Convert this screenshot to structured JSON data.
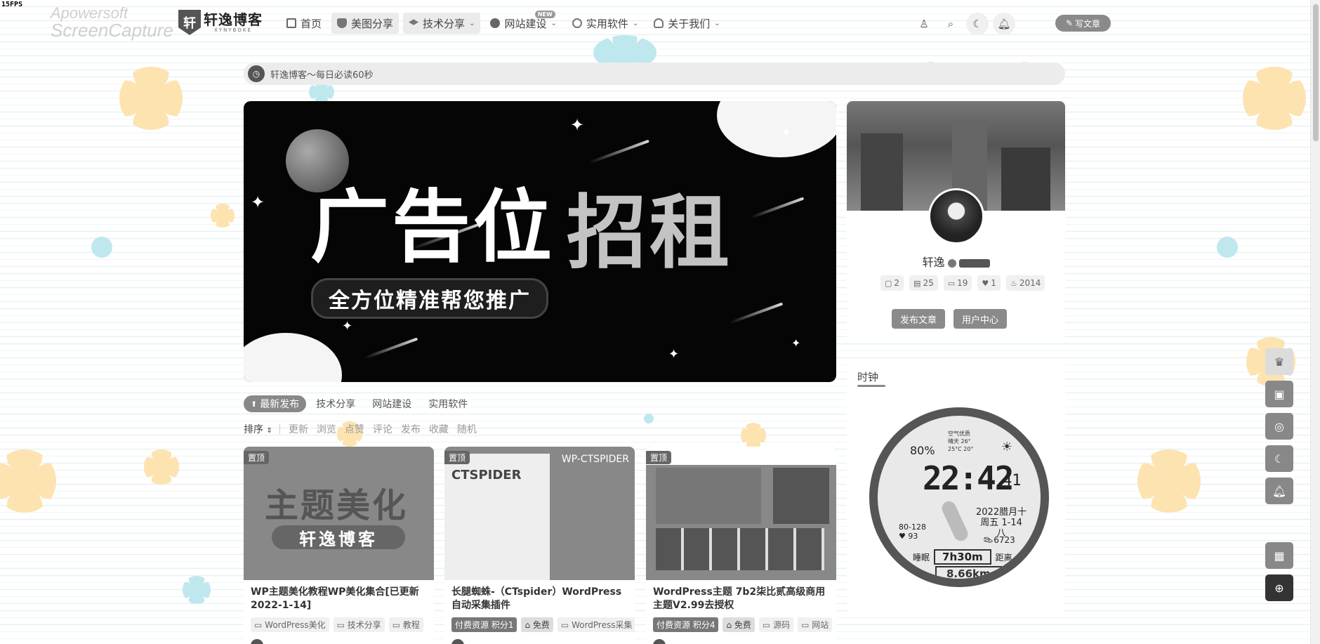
{
  "overlay": {
    "fps": "15FPS",
    "watermark_line1": "Apowersoft",
    "watermark_line2": "ScreenCapture"
  },
  "header": {
    "logo_name": "轩逸博客",
    "logo_sub": "XYNYBOKE",
    "nav": [
      {
        "label": "首页",
        "icon": "home-icon",
        "dropdown": false
      },
      {
        "label": "美图分享",
        "icon": "image-icon",
        "dropdown": false
      },
      {
        "label": "技术分享",
        "icon": "graduation-cap-icon",
        "dropdown": true
      },
      {
        "label": "网站建设",
        "icon": "globe-icon",
        "dropdown": true,
        "badge": "NEW"
      },
      {
        "label": "实用软件",
        "icon": "apps-icon",
        "dropdown": true
      },
      {
        "label": "关于我们",
        "icon": "users-icon",
        "dropdown": true
      }
    ],
    "write_button": "写文章"
  },
  "notice": {
    "text": "轩逸博客～每日必读60秒"
  },
  "banner": {
    "headline_a": "广告位",
    "headline_b": "招租",
    "slogan": "全方位精准帮您推广"
  },
  "tabs": {
    "items": [
      "最新发布",
      "技术分享",
      "网站建设",
      "实用软件"
    ],
    "active": 0
  },
  "sort": {
    "label": "排序",
    "options": [
      "更新",
      "浏览",
      "点赞",
      "评论",
      "发布",
      "收藏",
      "随机"
    ]
  },
  "cards": [
    {
      "pin": "置顶",
      "title": "WP主题美化教程WP美化集合[已更新2022-1-14]",
      "tags": [
        "WordPress美化",
        "技术分享",
        "教程"
      ],
      "thumb_big": "主题美化",
      "thumb_pill": "轩逸博客"
    },
    {
      "pin": "置顶",
      "title": "长腿蜘蛛-（CTspider）WordPress 自动采集插件",
      "tags": [
        "付费资源 积分1",
        "免费",
        "WordPress采集"
      ],
      "thumb_head": "WP-CTSPIDER",
      "thumb_box": "CTSPIDER"
    },
    {
      "pin": "置顶",
      "title": "WordPress主题 7b2柒比贰高级商用主题V2.99去授权",
      "tags": [
        "付费资源 积分4",
        "免费",
        "源码",
        "网站"
      ]
    }
  ],
  "profile": {
    "name": "轩逸",
    "stats": [
      {
        "icon": "comments-icon",
        "value": "2"
      },
      {
        "icon": "file-icon",
        "value": "25"
      },
      {
        "icon": "message-icon",
        "value": "19"
      },
      {
        "icon": "heart-icon",
        "value": "1"
      },
      {
        "icon": "fire-icon",
        "value": "2014"
      }
    ],
    "btn_publish": "发布文章",
    "btn_center": "用户中心"
  },
  "clock_widget": {
    "title": "时钟",
    "battery": "80%",
    "air_label": "空气优质",
    "weather": "晴天  26°",
    "temps": "25°C  20°",
    "time": "22:42",
    "seconds": "41",
    "date_line1": "2022腊月十",
    "date_line2": "周五 1-14",
    "date_line3": "八",
    "hr_range": "80-128",
    "hr_value": "93",
    "steps": "6723",
    "sleep_label": "睡眠",
    "sleep_value": "7h30m",
    "dist_label": "距离",
    "distance": "8.66km"
  },
  "colors": {
    "accent": "#888888",
    "dark": "#333333",
    "panel": "#ffffff",
    "stripe": "#e3f1f1"
  }
}
